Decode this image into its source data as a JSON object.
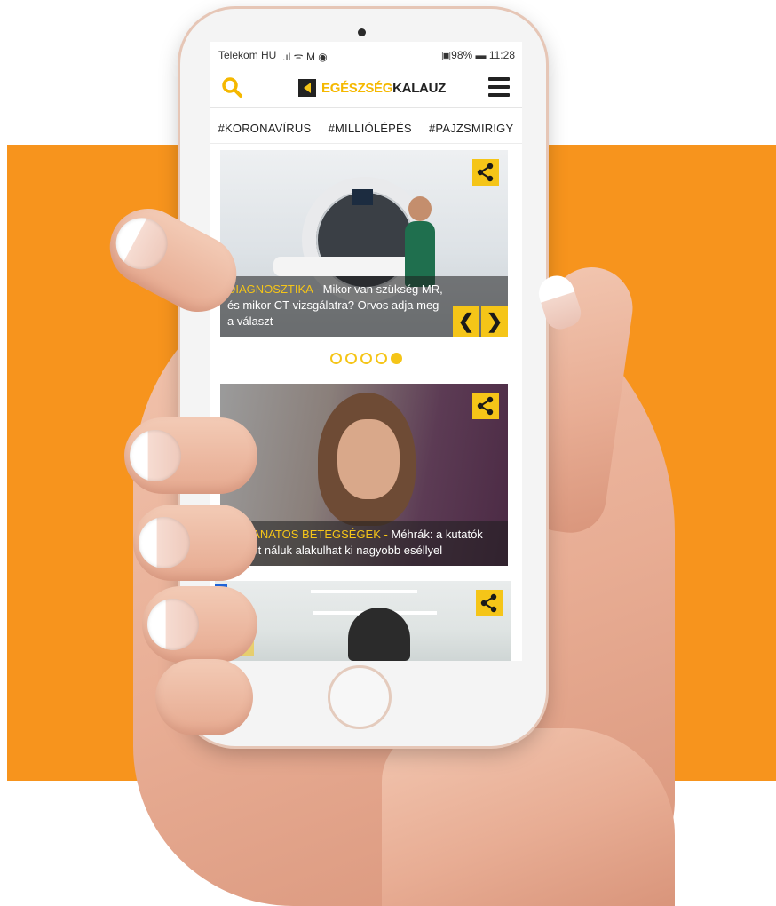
{
  "colors": {
    "background_band": "#f7941d",
    "accent": "#f5c518",
    "text_dark": "#222222"
  },
  "status_bar": {
    "carrier": "Telekom HU",
    "signal_icons": ".ıl ᯤ M ◉",
    "right": "▣98% ▬ 11:28"
  },
  "header": {
    "logo_part1": "EGÉSZSÉG",
    "logo_part2": "KALAUZ",
    "search_icon": "search-icon",
    "menu_icon": "hamburger-menu-icon"
  },
  "tags": [
    "#KORONAVÍRUS",
    "#MILLIÓLÉPÉS",
    "#PAJZSMIRIGY"
  ],
  "carousel": {
    "slide": {
      "category": "DIAGNOSZTIKA",
      "separator": " - ",
      "title": "Mikor van szükség MR, és mikor CT-vizsgálatra? Orvos adja meg a választ"
    },
    "prev_label": "❮",
    "next_label": "❯",
    "dots_total": 5,
    "active_dot": 5
  },
  "articles": [
    {
      "category": "DAGANATOS BETEGSÉGEK",
      "separator": " - ",
      "title": "Méhrák: a kutatók szerint náluk alakulhat ki nagyobb eséllyel"
    }
  ],
  "scroll_top_label": "︿"
}
